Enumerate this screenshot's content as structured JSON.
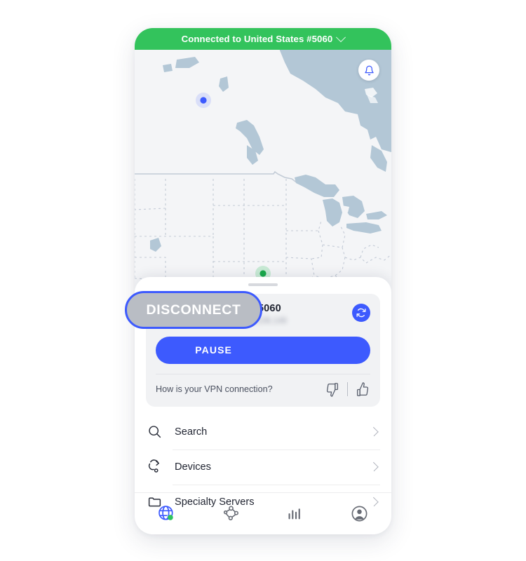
{
  "app": {
    "status_header": {
      "text": "Connected to United States #5060",
      "chevron_icon": "chevron-down-icon",
      "bg_color": "#33c35c",
      "text_color": "#ffffff"
    },
    "map": {
      "notification_icon": "bell-icon",
      "connected_marker_color": "#2ec45f",
      "other_marker_color": "#3d5afe",
      "land_color": "#f4f5f7",
      "water_color": "#b3c7d6"
    },
    "server_card": {
      "flag_icon": "us-flag-icon",
      "name": "United States #5060",
      "ip_line": "IP address: 207.106.106.149",
      "refresh_icon": "refresh-icon",
      "pause_label": "PAUSE",
      "disconnect_label": "DISCONNECT",
      "feedback_question": "How is your VPN connection?",
      "thumbs_down_icon": "thumbs-down-icon",
      "thumbs_up_icon": "thumbs-up-icon",
      "accent_color": "#3d5afe"
    },
    "menu": {
      "items": [
        {
          "label": "Search",
          "icon": "search-icon",
          "chevron": "chevron-right-icon"
        },
        {
          "label": "Devices",
          "icon": "devices-icon",
          "chevron": "chevron-right-icon"
        },
        {
          "label": "Specialty Servers",
          "icon": "folder-icon",
          "chevron": "chevron-right-icon"
        }
      ]
    },
    "tabbar": {
      "tabs": [
        {
          "name": "vpn",
          "icon": "globe-connected-icon",
          "active": true
        },
        {
          "name": "mesh",
          "icon": "mesh-network-icon",
          "active": false
        },
        {
          "name": "stats",
          "icon": "bar-chart-icon",
          "active": false
        },
        {
          "name": "profile",
          "icon": "profile-icon",
          "active": false
        }
      ],
      "active_color": "#3d5afe",
      "inactive_color": "#676b74"
    },
    "highlight": {
      "target": "DISCONNECT",
      "outline_color": "#3d5afe",
      "fill_color": "#b9bdc4"
    }
  }
}
